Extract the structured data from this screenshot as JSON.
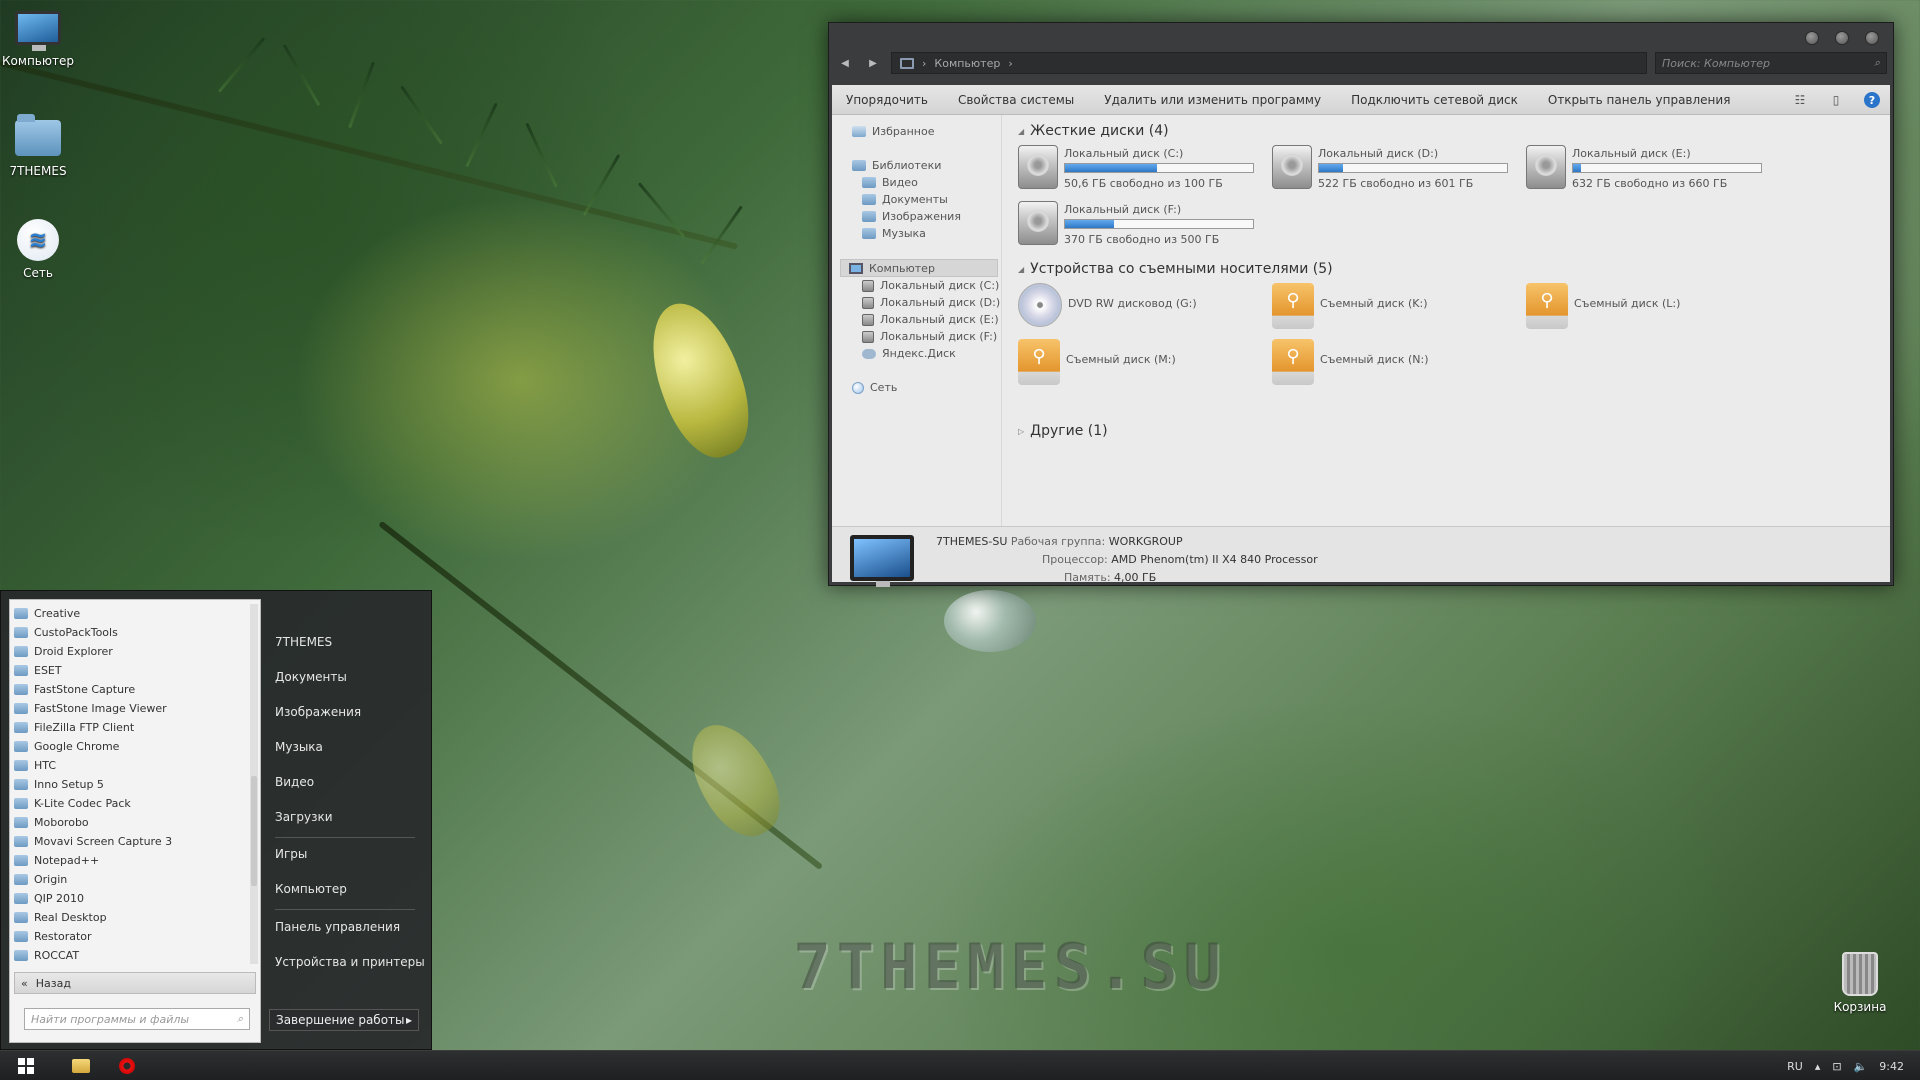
{
  "desktop": {
    "icons": [
      {
        "label": "Компьютер",
        "icon": "computer-icon"
      },
      {
        "label": "7THEMES",
        "icon": "folder-icon"
      },
      {
        "label": "Сеть",
        "icon": "network-icon"
      }
    ],
    "recycle_bin": {
      "label": "Корзина",
      "icon": "recycle-bin-icon"
    },
    "watermark": "7THEMES.SU"
  },
  "explorer": {
    "address": "Компьютер",
    "search_placeholder": "Поиск: Компьютер",
    "commands": [
      "Упорядочить",
      "Свойства системы",
      "Удалить или изменить программу",
      "Подключить сетевой диск",
      "Открыть панель управления"
    ],
    "nav": {
      "favorites": "Избранное",
      "libraries": "Библиотеки",
      "library_items": [
        "Видео",
        "Документы",
        "Изображения",
        "Музыка"
      ],
      "computer": "Компьютер",
      "computer_items": [
        "Локальный диск (C:)",
        "Локальный диск (D:)",
        "Локальный диск (E:)",
        "Локальный диск (F:)",
        "Яндекс.Диск"
      ],
      "network": "Сеть"
    },
    "groups": {
      "hard_disks": "Жесткие диски (4)",
      "removable": "Устройства со съемными носителями (5)",
      "other": "Другие (1)"
    },
    "drives": [
      {
        "name": "Локальный диск (C:)",
        "free": "50,6 ГБ свободно из 100 ГБ",
        "used_fraction": 0.49
      },
      {
        "name": "Локальный диск (D:)",
        "free": "522 ГБ свободно из 601 ГБ",
        "used_fraction": 0.13
      },
      {
        "name": "Локальный диск (E:)",
        "free": "632 ГБ свободно из 660 ГБ",
        "used_fraction": 0.04
      },
      {
        "name": "Локальный диск (F:)",
        "free": "370 ГБ свободно из 500 ГБ",
        "used_fraction": 0.26
      }
    ],
    "removable": [
      "DVD RW дисковод (G:)",
      "Съемный диск (K:)",
      "Съемный диск (L:)",
      "Съемный диск (M:)",
      "Съемный диск (N:)"
    ],
    "details": {
      "computer_name": "7THEMES-SU",
      "workgroup_label": "Рабочая группа:",
      "workgroup": "WORKGROUP",
      "cpu_label": "Процессор:",
      "cpu": "AMD Phenom(tm) II X4 840 Processor",
      "ram_label": "Память:",
      "ram": "4,00 ГБ"
    }
  },
  "start_menu": {
    "programs": [
      "Creative",
      "CustoPackTools",
      "Droid Explorer",
      "ESET",
      "FastStone Capture",
      "FastStone Image Viewer",
      "FileZilla FTP Client",
      "Google Chrome",
      "HTC",
      "Inno Setup 5",
      "K-Lite Codec Pack",
      "Moborobo",
      "Movavi Screen Capture 3",
      "Notepad++",
      "Origin",
      "QIP 2010",
      "Real Desktop",
      "Restorator",
      "ROCCAT"
    ],
    "back": "Назад",
    "search_placeholder": "Найти программы и файлы",
    "right_items": [
      "7THEMES",
      "Документы",
      "Изображения",
      "Музыка",
      "Видео",
      "Загрузки",
      "Игры",
      "Компьютер",
      "Панель управления",
      "Устройства и принтеры"
    ],
    "shutdown": "Завершение работы"
  },
  "taskbar": {
    "lang": "RU",
    "time": "9:42"
  }
}
